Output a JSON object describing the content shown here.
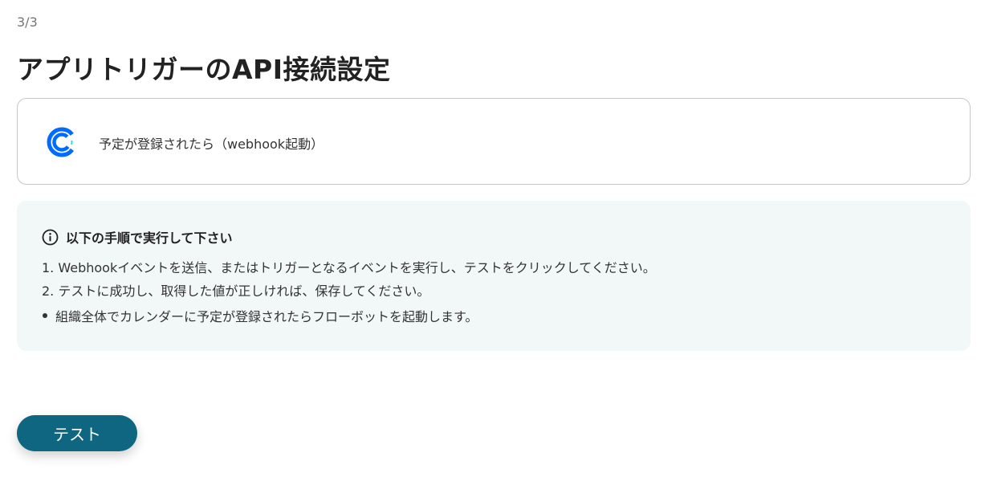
{
  "header": {
    "step": "3/3",
    "title": "アプリトリガーのAPI接続設定"
  },
  "trigger": {
    "icon": "calendly-logo-icon",
    "label": "予定が登録されたら（webhook起動）",
    "brand_color": "#006BFF"
  },
  "instructions": {
    "icon": "info-icon",
    "title": "以下の手順で実行して下さい",
    "steps": [
      "1. Webhookイベントを送信、またはトリガーとなるイベントを実行し、テストをクリックしてください。",
      "2. テストに成功し、取得した値が正しければ、保存してください。"
    ],
    "bullets": [
      "組織全体でカレンダーに予定が登録されたらフローボットを起動します。"
    ],
    "background_color": "#f1f8f7"
  },
  "actions": {
    "test_label": "テスト",
    "button_color": "#0e6680"
  }
}
